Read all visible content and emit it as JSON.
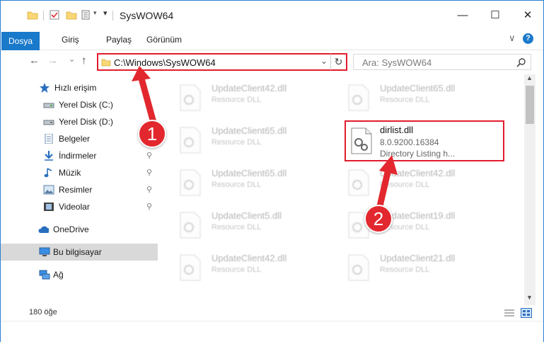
{
  "window": {
    "title": "SysWOW64",
    "minimize": "—",
    "maximize": "☐",
    "close": "✕"
  },
  "ribbon": {
    "tabs": [
      "Dosya",
      "Giriş",
      "Paylaş",
      "Görünüm"
    ],
    "expand": "∨",
    "help": "?"
  },
  "nav": {
    "back": "←",
    "forward": "→",
    "recent": "⌄",
    "up": "↑",
    "address": "C:\\Windows\\SysWOW64",
    "address_dropdown": "⌄",
    "refresh": "↻",
    "search_placeholder": "Ara: SysWOW64"
  },
  "sidebar": {
    "items": [
      {
        "label": "Hızlı erişim",
        "icon": "star-icon"
      },
      {
        "label": "Yerel Disk (C:)",
        "icon": "drive-icon",
        "pin": "📌"
      },
      {
        "label": "Yerel Disk (D:)",
        "icon": "drive-icon"
      },
      {
        "label": "Belgeler",
        "icon": "documents-icon",
        "pin": "📌"
      },
      {
        "label": "İndirmeler",
        "icon": "downloads-icon",
        "pin": "📌"
      },
      {
        "label": "Müzik",
        "icon": "music-icon",
        "pin": "📌"
      },
      {
        "label": "Resimler",
        "icon": "pictures-icon",
        "pin": "📌"
      },
      {
        "label": "Videolar",
        "icon": "videos-icon",
        "pin": "📌"
      },
      {
        "label": "OneDrive",
        "icon": "cloud-icon"
      },
      {
        "label": "Bu bilgisayar",
        "icon": "computer-icon",
        "selected": true
      },
      {
        "label": "Ağ",
        "icon": "network-icon"
      }
    ]
  },
  "files": [
    {
      "name": "UpdateClient42.dll",
      "sub": "Resource DLL"
    },
    {
      "name": "UpdateClient65.dll",
      "sub": "Resource DLL"
    },
    {
      "name": "UpdateClient65.dll",
      "sub": "Resource DLL"
    },
    {
      "name": "UpdateClient65.dll",
      "sub": "Resource DLL"
    },
    {
      "name": "UpdateClient42.dll",
      "sub": "Resource DLL"
    },
    {
      "name": "UpdateClient5.dll",
      "sub": "Resource DLL"
    },
    {
      "name": "UpdateClient19.dll",
      "sub": "Resource DLL"
    },
    {
      "name": "UpdateClient42.dll",
      "sub": "Resource DLL"
    },
    {
      "name": "UpdateClient21.dll",
      "sub": "Resource DLL"
    }
  ],
  "highlighted_file": {
    "name": "dirlist.dll",
    "version": "8.0.9200.16384",
    "description": "Directory Listing h..."
  },
  "annotations": {
    "step1": "1",
    "step2": "2",
    "color": "#e2282e"
  },
  "status": {
    "count": "180 öğe"
  }
}
